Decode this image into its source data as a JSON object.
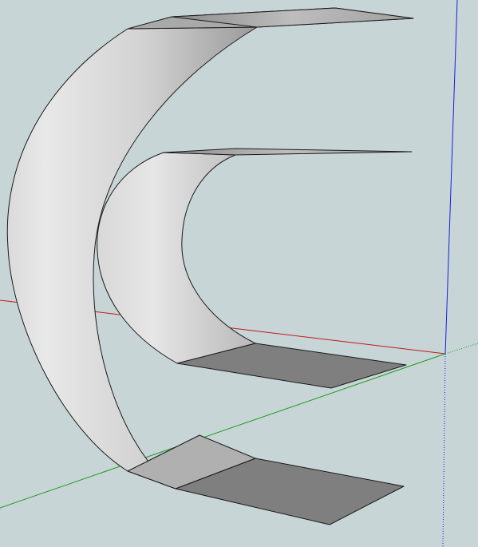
{
  "viewport": {
    "background_color": "#c7d5d6"
  },
  "axes": {
    "x_color": "#c21a1a",
    "y_color": "#1f9a1f",
    "z_color": "#1d1de0"
  },
  "model": {
    "shape": "two curved shelf ribbons",
    "face_light": "#e6e6e6",
    "face_dark": "#7f7f7f",
    "edge_color": "#1a1a1a"
  }
}
